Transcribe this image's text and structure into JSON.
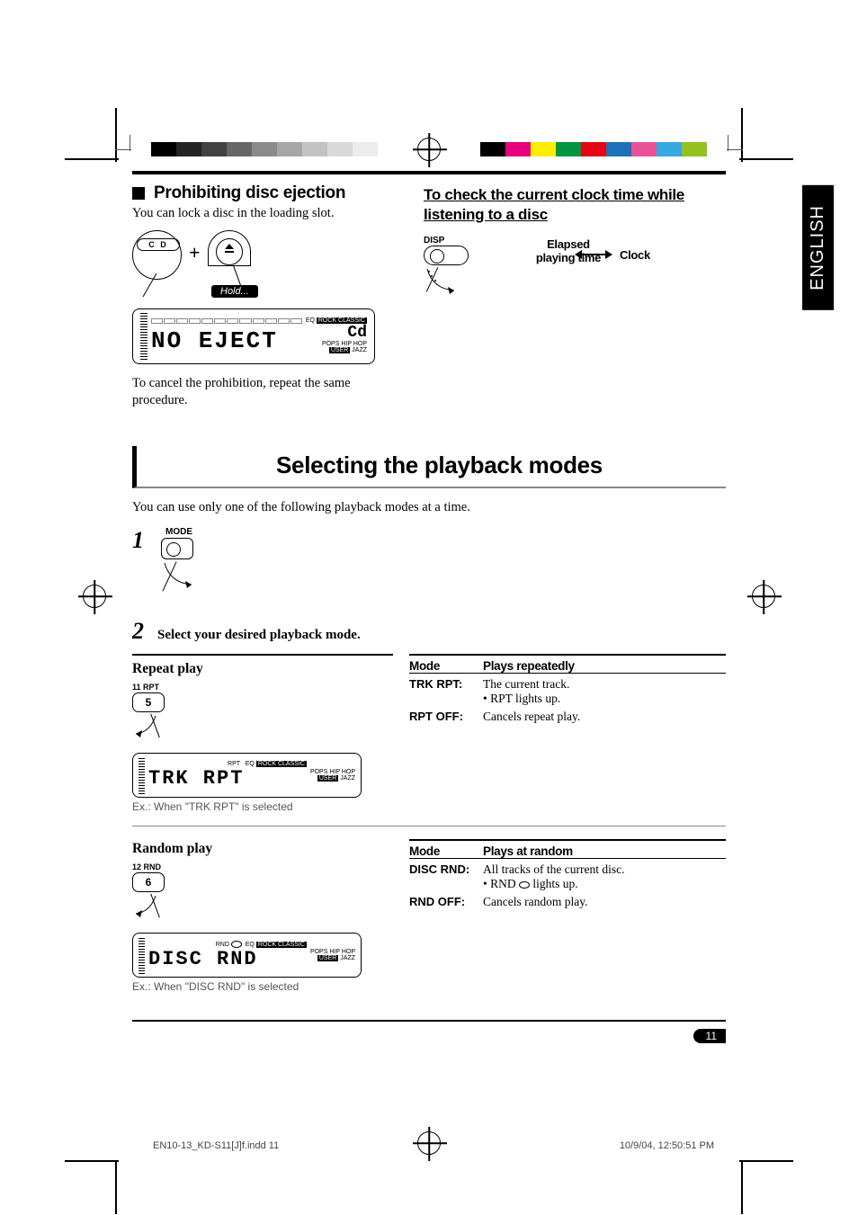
{
  "language_tab": "ENGLISH",
  "section1": {
    "title": "Prohibiting disc ejection",
    "intro": "You can lock a disc in the loading slot.",
    "cd_label": "C D",
    "hold_badge": "Hold...",
    "lcd_main": "NO EJECT",
    "lcd_side": "Cd",
    "cancel_note": "To cancel the prohibition, repeat the same procedure."
  },
  "clock": {
    "heading": "To check the current clock time while listening to a disc",
    "disp_label": "DISP",
    "left_label": "Elapsed playing time",
    "right_label": "Clock"
  },
  "section2": {
    "title": "Selecting the playback modes",
    "intro": "You can use only one of the following playback modes at a time.",
    "step1_num": "1",
    "step1_label": "MODE",
    "step2_num": "2",
    "step2_text": "Select your desired playback mode."
  },
  "repeat": {
    "heading": "Repeat play",
    "btn_label": "11  RPT",
    "btn_num": "5",
    "lcd": "TRK  RPT",
    "caption": "Ex.: When \"TRK RPT\" is selected",
    "col_mode": "Mode",
    "col_desc": "Plays repeatedly",
    "rows": [
      {
        "mode": "TRK RPT:",
        "desc": "The current track.",
        "sub": "RPT lights up."
      },
      {
        "mode": "RPT OFF:",
        "desc": "Cancels repeat play."
      }
    ]
  },
  "random": {
    "heading": "Random play",
    "btn_label": "12  RND",
    "btn_num": "6",
    "lcd": "DISC RND",
    "caption": "Ex.: When \"DISC RND\" is selected",
    "col_mode": "Mode",
    "col_desc": "Plays at random",
    "rows": [
      {
        "mode": "DISC RND:",
        "desc": "All tracks of the current disc.",
        "sub_pre": "RND ",
        "sub_post": " lights up."
      },
      {
        "mode": "RND OFF:",
        "desc": "Cancels random play."
      }
    ]
  },
  "page_number": "11",
  "footer": {
    "filename": "EN10-13_KD-S11[J]f.indd   11",
    "timestamp": "10/9/04, 12:50:51 PM"
  }
}
